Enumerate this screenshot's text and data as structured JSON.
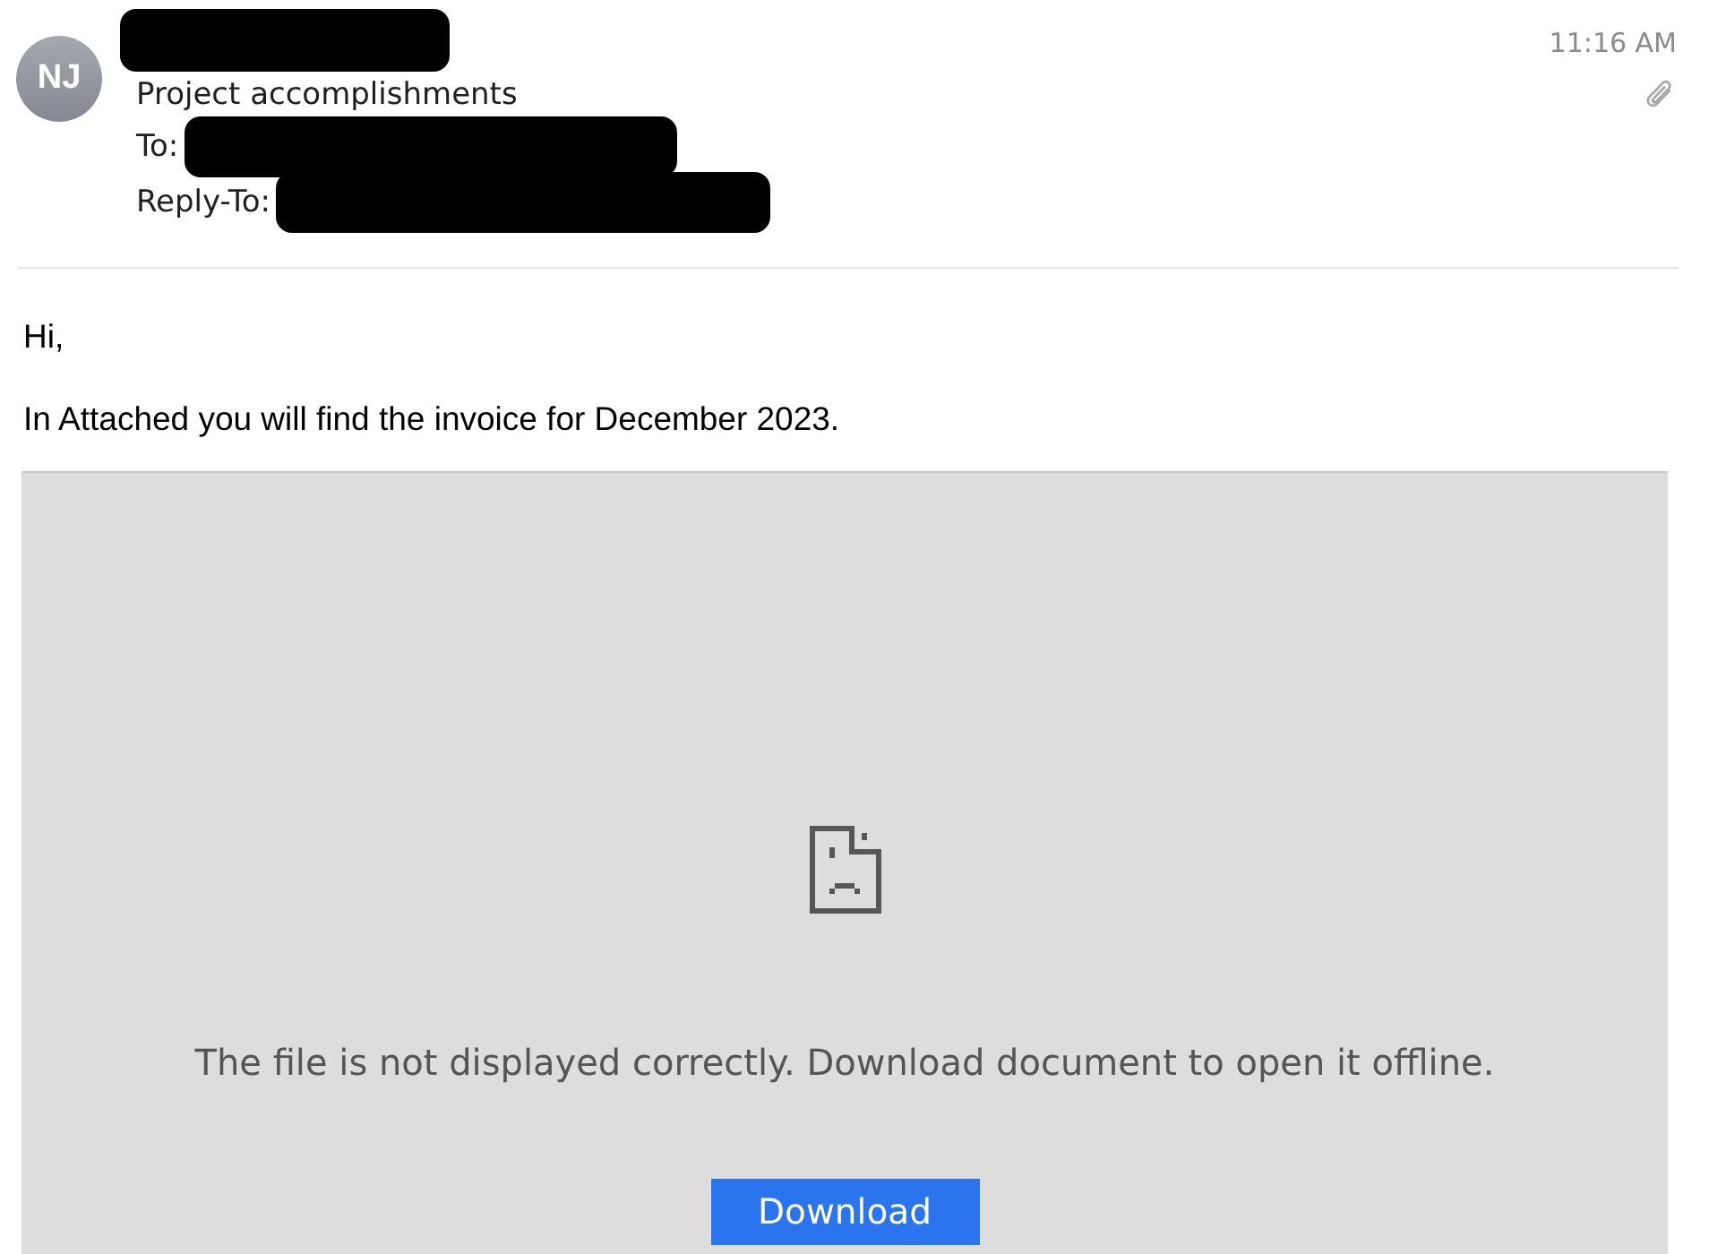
{
  "message": {
    "sender": {
      "initials": "NJ",
      "redacted": true
    },
    "subject": "Project accomplishments",
    "recipients": [
      {
        "label": "To:",
        "redacted": true
      },
      {
        "label": "Reply-To:",
        "redacted": true
      }
    ],
    "time": "11:16 AM",
    "has_attachment": true
  },
  "body": {
    "paragraphs": [
      "Hi,",
      "In Attached you will find the invoice for December 2023."
    ]
  },
  "attachment_preview": {
    "message": "The file is not displayed correctly. Download document to open it offline.",
    "button": "Download"
  }
}
